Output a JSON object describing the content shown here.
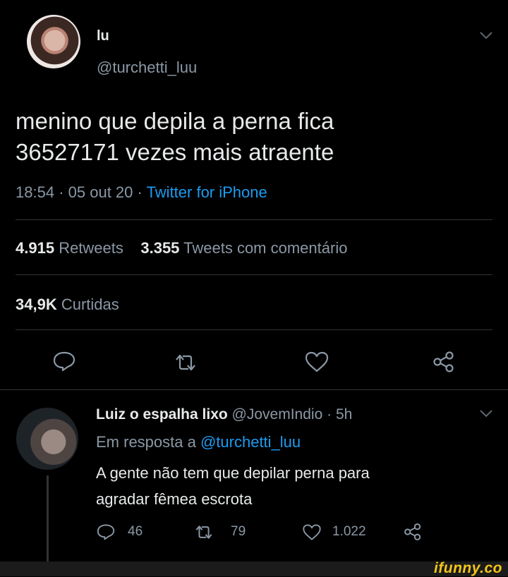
{
  "tweet": {
    "author_name": "lu",
    "author_handle": "@turchetti_luu",
    "text_line1": "menino que depila a perna fica",
    "text_line2": "36527171 vezes mais atraente",
    "time": "18:54",
    "date": "05 out 20",
    "separator": "·",
    "client": "Twitter for iPhone",
    "retweets_count": "4.915",
    "retweets_label": "Retweets",
    "quote_count": "3.355",
    "quote_label": "Tweets com comentário",
    "likes_count": "34,9K",
    "likes_label": "Curtidas"
  },
  "reply": {
    "author_name": "Luiz o espalha lixo",
    "author_handle": "@JovemIndio",
    "separator": "·",
    "time_ago": "5h",
    "reply_prefix": "Em resposta a",
    "reply_to": "@turchetti_luu",
    "text_line1": "A gente não tem que depilar perna para",
    "text_line2": "agradar fêmea escrota",
    "replies": "46",
    "retweets": "79",
    "likes": "1.022"
  },
  "watermark": "ifunny.co",
  "colors": {
    "background": "#000000",
    "text": "#e7e9ea",
    "muted": "#8b98a5",
    "link": "#1d9bf0",
    "divider": "#2f3336",
    "watermark": "#f5c518"
  },
  "icons": [
    "reply-icon",
    "retweet-icon",
    "like-icon",
    "share-icon",
    "chevron-down-icon"
  ]
}
